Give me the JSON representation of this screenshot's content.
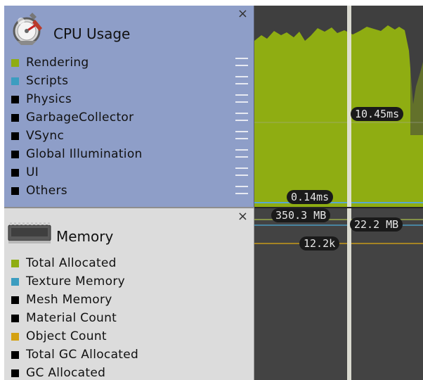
{
  "cpu": {
    "title": "CPU Usage",
    "close": "×",
    "legend": [
      {
        "label": "Rendering",
        "color": "#8fad12"
      },
      {
        "label": "Scripts",
        "color": "#3c9dc0"
      },
      {
        "label": "Physics",
        "color": "#000000"
      },
      {
        "label": "GarbageCollector",
        "color": "#000000"
      },
      {
        "label": "VSync",
        "color": "#000000"
      },
      {
        "label": "Global Illumination",
        "color": "#000000"
      },
      {
        "label": "UI",
        "color": "#000000"
      },
      {
        "label": "Others",
        "color": "#000000"
      }
    ],
    "label_high": "10.45ms",
    "label_low": "0.14ms"
  },
  "memory": {
    "title": "Memory",
    "close": "×",
    "legend": [
      {
        "label": "Total Allocated",
        "color": "#8fad12"
      },
      {
        "label": "Texture Memory",
        "color": "#3c9dc0"
      },
      {
        "label": "Mesh Memory",
        "color": "#000000"
      },
      {
        "label": "Material Count",
        "color": "#000000"
      },
      {
        "label": "Object Count",
        "color": "#d4a112"
      },
      {
        "label": "Total GC Allocated",
        "color": "#000000"
      },
      {
        "label": "GC Allocated",
        "color": "#000000"
      }
    ],
    "label_total": "350.3 MB",
    "label_texture": "22.2 MB",
    "label_objects": "12.2k"
  },
  "colors": {
    "rendering_fill": "#8fad12",
    "chart_bg": "#404040",
    "cursor": "#e3e3d8"
  }
}
